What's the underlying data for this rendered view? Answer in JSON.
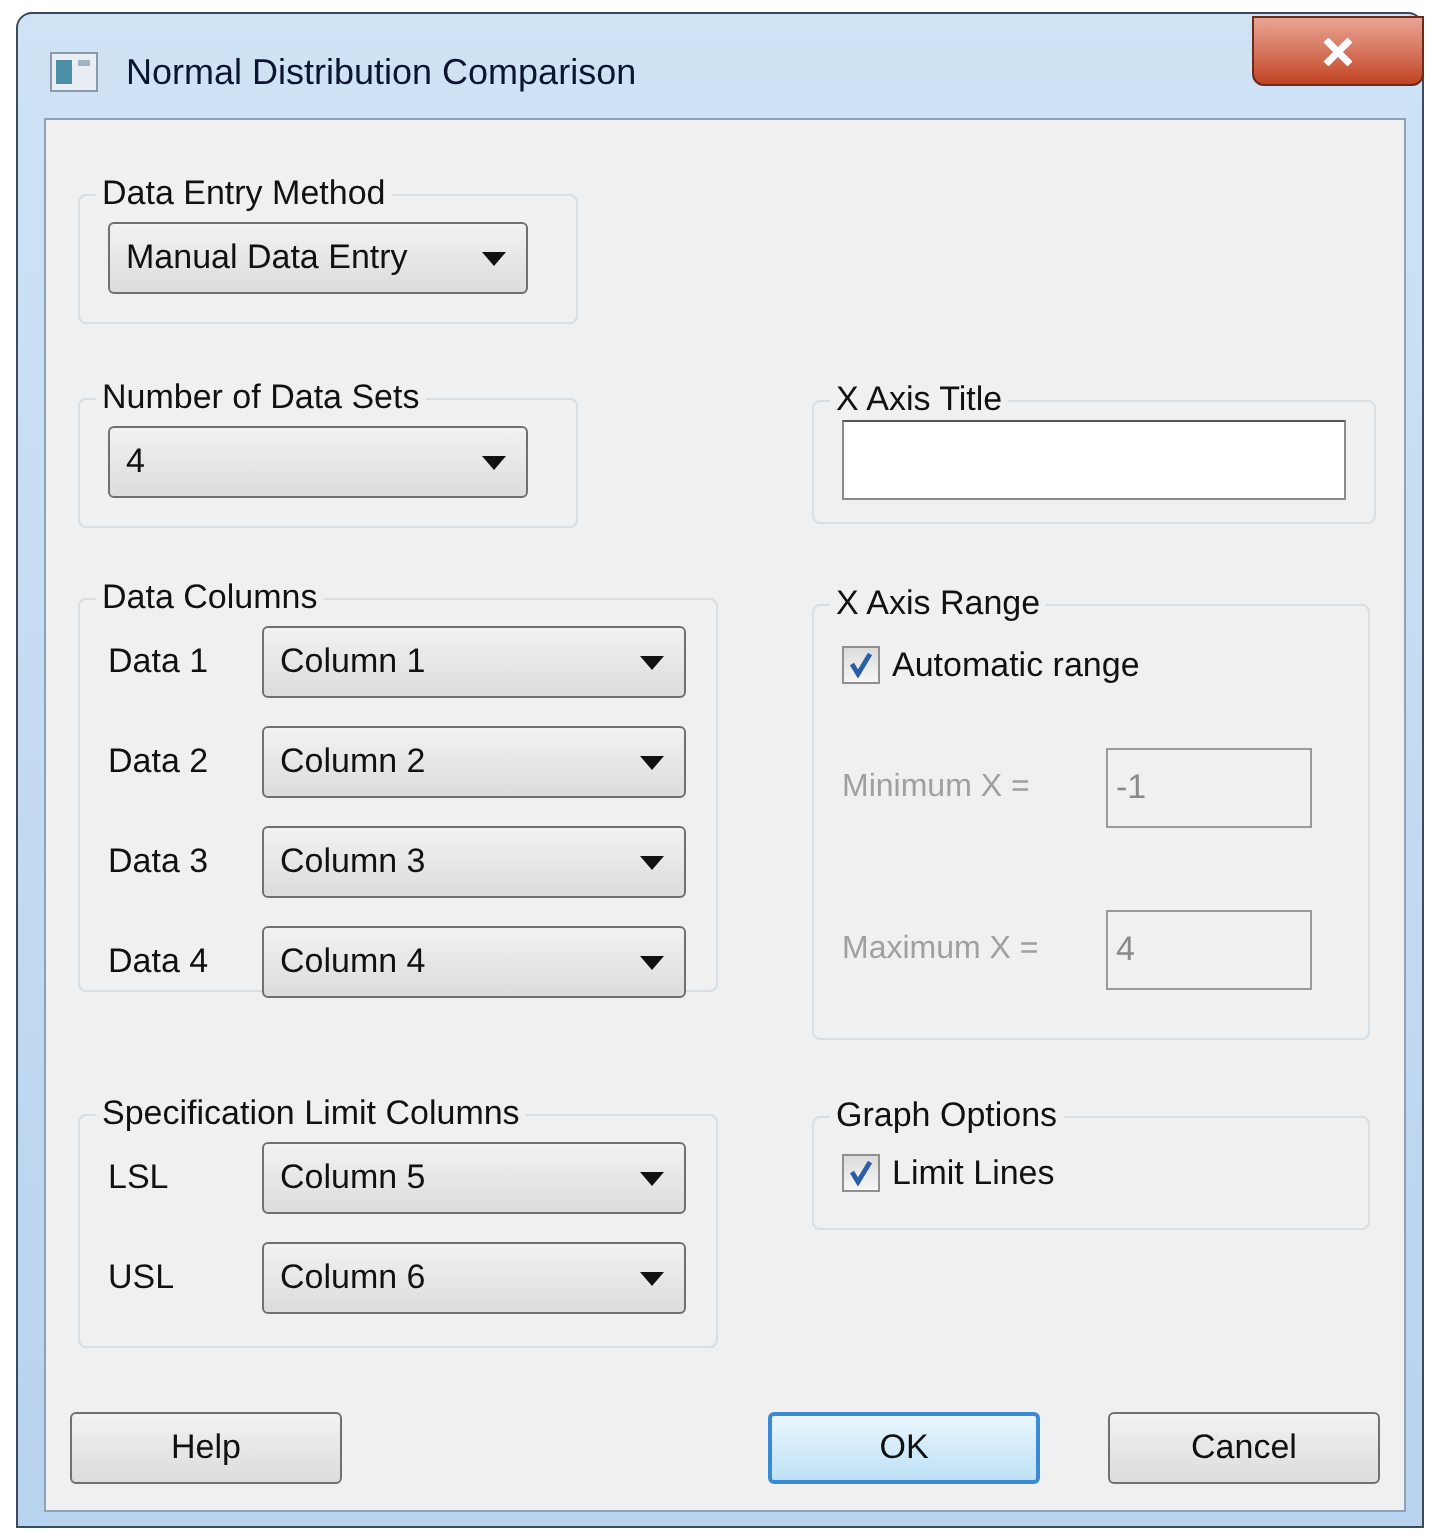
{
  "window": {
    "title": "Normal Distribution Comparison"
  },
  "data_entry_method": {
    "title": "Data Entry Method",
    "value": "Manual Data Entry"
  },
  "number_of_data_sets": {
    "title": "Number of Data Sets",
    "value": "4"
  },
  "data_columns": {
    "title": "Data Columns",
    "rows": [
      {
        "label": "Data 1",
        "value": "Column 1"
      },
      {
        "label": "Data 2",
        "value": "Column 2"
      },
      {
        "label": "Data 3",
        "value": "Column 3"
      },
      {
        "label": "Data 4",
        "value": "Column 4"
      }
    ]
  },
  "specification_limit_columns": {
    "title": "Specification Limit Columns",
    "rows": [
      {
        "label": "LSL",
        "value": "Column 5"
      },
      {
        "label": "USL",
        "value": "Column 6"
      }
    ]
  },
  "x_axis_title": {
    "title": "X Axis Title"
  },
  "x_axis_range": {
    "title": "X Axis Range",
    "automatic": {
      "label": "Automatic range",
      "checked": true
    },
    "fields": [
      {
        "label": "Minimum X =",
        "value": "-1",
        "disabled": true
      },
      {
        "label": "Maximum X =",
        "value": "4",
        "disabled": true
      }
    ]
  },
  "graph_options": {
    "title": "Graph Options",
    "options": [
      {
        "label": "Limit Lines",
        "checked": true
      }
    ]
  },
  "buttons": [
    {
      "label": "Help",
      "default": false
    },
    {
      "label": "OK",
      "default": true
    },
    {
      "label": "Cancel",
      "default": false
    }
  ]
}
